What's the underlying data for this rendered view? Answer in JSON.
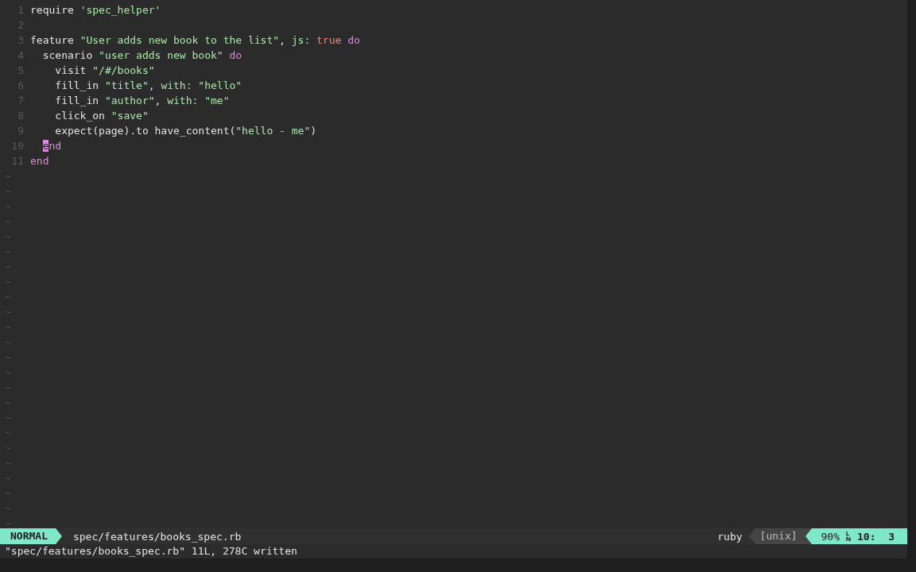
{
  "lines": [
    {
      "number": "1",
      "tokens": [
        {
          "kind": "plain",
          "text": "require "
        },
        {
          "kind": "string",
          "text": "'spec_helper'"
        }
      ]
    },
    {
      "number": "2"
    },
    {
      "number": "3",
      "tokens": [
        {
          "kind": "plain",
          "text": "feature "
        },
        {
          "kind": "string",
          "text": "\"User adds new book to the list\""
        },
        {
          "kind": "plain",
          "text": ", "
        },
        {
          "kind": "string",
          "text": "js:"
        },
        {
          "kind": "constant",
          "text": " true"
        },
        {
          "kind": "keyword",
          "text": " do"
        }
      ],
      "children": [
        {
          "number": "4",
          "tokens": [
            {
              "kind": "plain",
              "text": "scenario "
            },
            {
              "kind": "string",
              "text": "\"user adds new book\""
            },
            {
              "kind": "keyword",
              "text": " do"
            }
          ],
          "children": [
            {
              "number": "5",
              "tokens": [
                {
                  "kind": "plain",
                  "text": "visit "
                },
                {
                  "kind": "string",
                  "text": "\"/#/books\""
                }
              ]
            },
            {
              "number": "6",
              "tokens": [
                {
                  "kind": "plain",
                  "text": "fill_in "
                },
                {
                  "kind": "string",
                  "text": "\"title\""
                },
                {
                  "kind": "plain",
                  "text": ", "
                },
                {
                  "kind": "string",
                  "text": "with:"
                },
                {
                  "kind": "string",
                  "text": " \"hello\""
                }
              ]
            },
            {
              "number": "7",
              "tokens": [
                {
                  "kind": "plain",
                  "text": "fill_in "
                },
                {
                  "kind": "string",
                  "text": "\"author\""
                },
                {
                  "kind": "plain",
                  "text": ", "
                },
                {
                  "kind": "string",
                  "text": "with:"
                },
                {
                  "kind": "string",
                  "text": " \"me\""
                }
              ]
            },
            {
              "number": "8",
              "tokens": [
                {
                  "kind": "plain",
                  "text": "click_on "
                },
                {
                  "kind": "string",
                  "text": "\"save\""
                }
              ]
            },
            {
              "number": "9",
              "tokens": [
                {
                  "kind": "plain",
                  "text": "expect(page).to have_content("
                },
                {
                  "kind": "string",
                  "text": "\"hello - me\""
                },
                {
                  "kind": "plain",
                  "text": ")"
                }
              ]
            }
          ]
        },
        {
          "number": "10",
          "tokens": [
            {
              "kind": "cursor",
              "text": "e"
            },
            {
              "kind": "keyword",
              "text": "nd"
            }
          ]
        }
      ]
    },
    {
      "number": "11",
      "tokens": [
        {
          "kind": "keyword",
          "text": "end"
        }
      ]
    }
  ],
  "empty_lines": [
    "~",
    "~",
    "~",
    "~",
    "~",
    "~",
    "~",
    "~",
    "~",
    "~",
    "~",
    "~",
    "~",
    "~",
    "~",
    "~",
    "~",
    "~",
    "~",
    "~",
    "~",
    "~",
    "~",
    "~"
  ],
  "status_bar": {
    "mode": "NORMAL",
    "file": "spec/features/books_spec.rb",
    "filetype": "ruby",
    "fileformat": "[unix]",
    "percent": "90%",
    "position": "10:  3"
  },
  "command_line": "\"spec/features/books_spec.rb\" 11L, 278C written"
}
